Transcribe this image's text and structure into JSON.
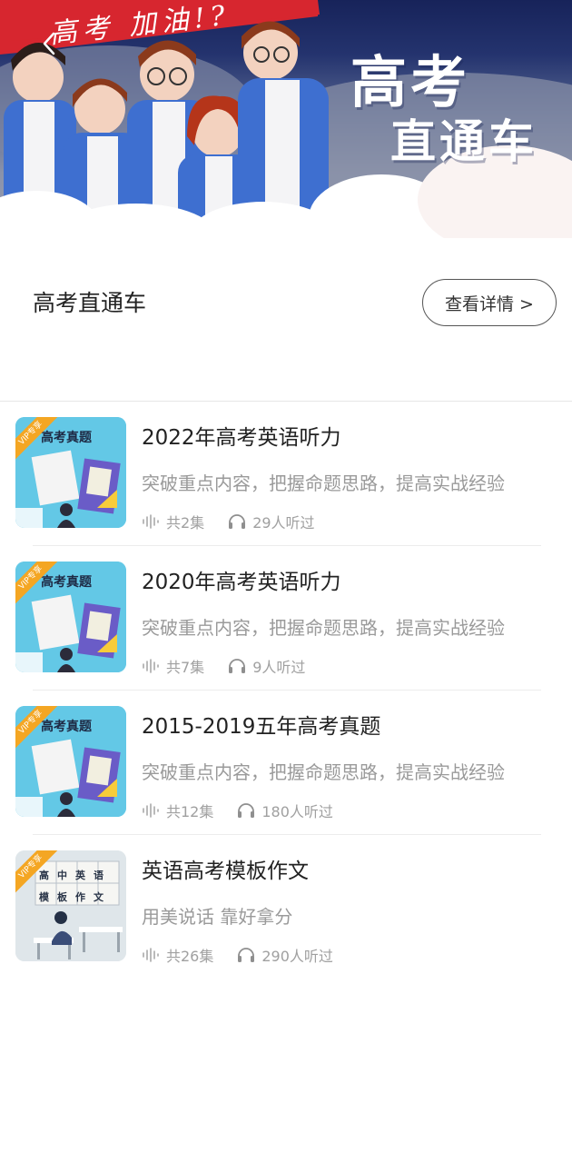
{
  "banner": {
    "ribbon_text": "高考 加油!?",
    "title_line1": "高考",
    "title_line2": "直通车"
  },
  "section": {
    "title": "高考直通车",
    "details_label": "查看详情 >"
  },
  "courses": [
    {
      "title": "2022年高考英语听力",
      "description": "突破重点内容，把握命题思路，提高实战经验",
      "episodes": "共2集",
      "listeners": "29人听过",
      "cover_tag": "VIP专享",
      "cover_title": "高考真题",
      "cover_style": "exam"
    },
    {
      "title": "2020年高考英语听力",
      "description": "突破重点内容，把握命题思路，提高实战经验",
      "episodes": "共7集",
      "listeners": "9人听过",
      "cover_tag": "VIP专享",
      "cover_title": "高考真题",
      "cover_style": "exam"
    },
    {
      "title": "2015-2019五年高考真题",
      "description": "突破重点内容，把握命题思路，提高实战经验",
      "episodes": "共12集",
      "listeners": "180人听过",
      "cover_tag": "VIP专享",
      "cover_title": "高考真题",
      "cover_style": "exam"
    },
    {
      "title": "英语高考模板作文",
      "description": "用美说话 靠好拿分",
      "episodes": "共26集",
      "listeners": "290人听过",
      "cover_tag": "VIP专享",
      "cover_title": "高中英语模板作文",
      "cover_style": "classroom"
    }
  ],
  "colors": {
    "ribbon": "#d7262f",
    "vip_tag": "#f4a623",
    "cover_exam_bg": "#63c8e6",
    "cover_classroom_bg": "#dfe6ea"
  }
}
